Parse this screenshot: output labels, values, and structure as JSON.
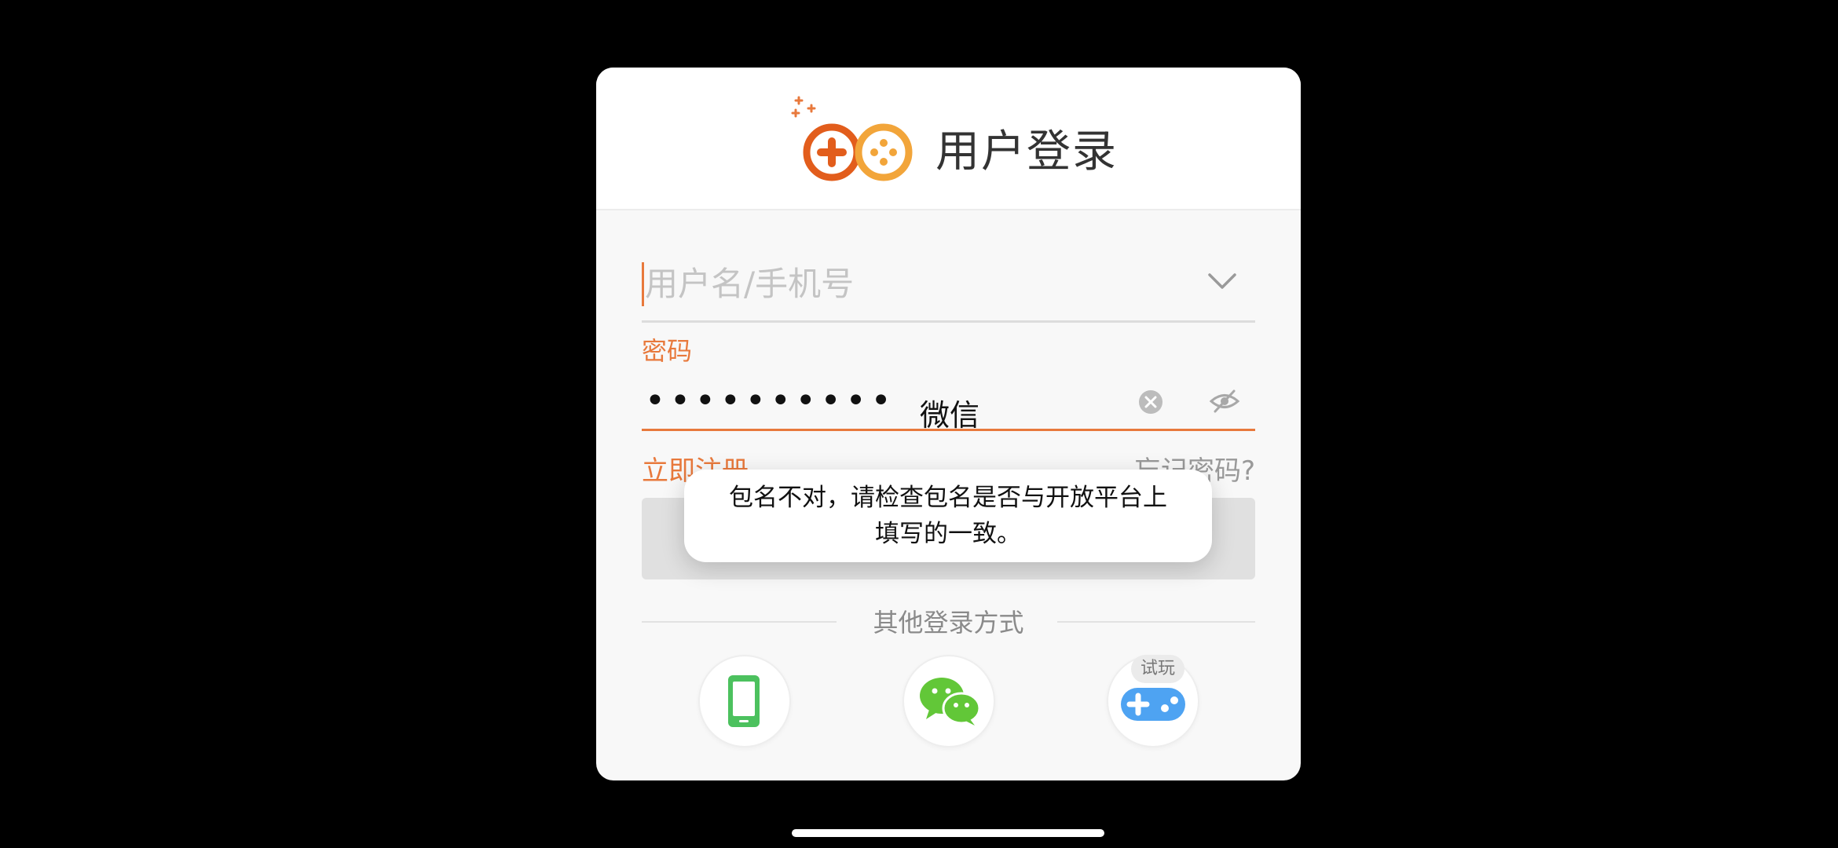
{
  "header": {
    "title": "用户登录",
    "logo_icon": "gamepad-plus-logo-icon"
  },
  "form": {
    "username_placeholder": "用户名/手机号",
    "username_value": "",
    "password_label": "密码",
    "password_masked": "••••••••••",
    "register_link": "立即注册",
    "forgot_link": "忘记密码?",
    "login_button_label": ""
  },
  "overlay": {
    "app_label": "微信"
  },
  "other_login": {
    "label": "其他登录方式",
    "methods": [
      {
        "name": "phone",
        "icon": "phone-icon"
      },
      {
        "name": "wechat",
        "icon": "wechat-icon"
      },
      {
        "name": "trial",
        "icon": "gamepad-icon",
        "badge": "试玩"
      }
    ]
  },
  "toast": {
    "line1": "包名不对，请检查包名是否与开放平台上",
    "line2": "填写的一致。"
  },
  "colors": {
    "accent": "#e8793c",
    "phone_green": "#4cc15e",
    "wechat_green": "#62c738",
    "trial_blue": "#4ea3f2"
  }
}
